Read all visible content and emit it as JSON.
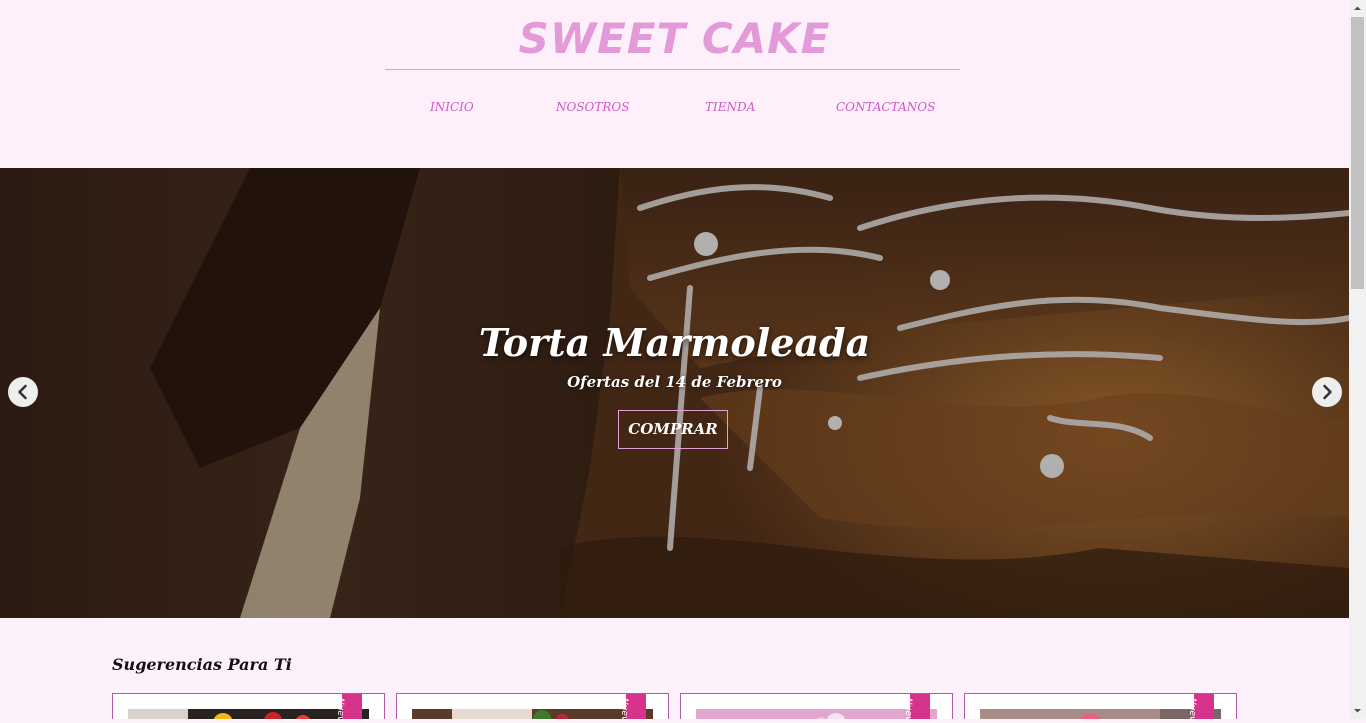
{
  "brand": {
    "name": "SWEET CAKE",
    "color": "#e29ad8"
  },
  "nav": {
    "items": [
      {
        "label": "INICIO"
      },
      {
        "label": "NOSOTROS"
      },
      {
        "label": "TIENDA"
      },
      {
        "label": "CONTACTANOS"
      }
    ]
  },
  "hero": {
    "title": "Torta Marmoleada",
    "subtitle": "Ofertas del 14 de Febrero",
    "button_label": "COMPRAR",
    "prev_icon": "chevron-left-icon",
    "next_icon": "chevron-right-icon"
  },
  "suggestions": {
    "title": "Sugerencias Para Ti",
    "cards": [
      {
        "badge": "Nuevo"
      },
      {
        "badge": "Nuevo"
      },
      {
        "badge": "Nuevo"
      },
      {
        "badge": "Nuevo"
      }
    ]
  },
  "colors": {
    "accent": "#d05ac4",
    "ribbon": "#d6338c",
    "card_border": "#b05ba6",
    "background": "#fdf2fb"
  }
}
